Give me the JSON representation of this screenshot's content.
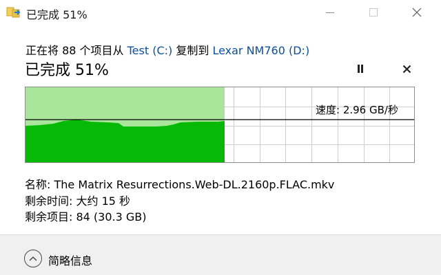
{
  "window": {
    "title": "已完成 51%",
    "icon": "copy-transfer-icon",
    "buttons": {
      "minimize": "minimize-icon",
      "maximize": "maximize-icon",
      "close": "close-icon"
    }
  },
  "header": {
    "prefix": "正在将 88 个项目从 ",
    "source": "Test (C:)",
    "middle": " 复制到 ",
    "destination": "Lexar NM760 (D:)",
    "status": "已完成 51%",
    "progress_percent": 51,
    "controls": {
      "pause": "pause-icon",
      "cancel": "close-icon"
    }
  },
  "graph": {
    "speed_text": "速度: 2.96 GB/秒",
    "progress_fraction": 0.51,
    "colors": {
      "done_light": "#a9e59a",
      "done_dark": "#07b907",
      "grid": "#cfcfcf",
      "speed_line": "#000000"
    }
  },
  "details": {
    "name": "名称: The Matrix Resurrections.Web-DL.2160p.FLAC.mkv",
    "time_remaining": "剩余时间: 大约 15 秒",
    "items_remaining": "剩余项目: 84 (30.3 GB)"
  },
  "footer": {
    "toggle_label": "简略信息",
    "toggle_icon": "chevron-up-icon"
  }
}
